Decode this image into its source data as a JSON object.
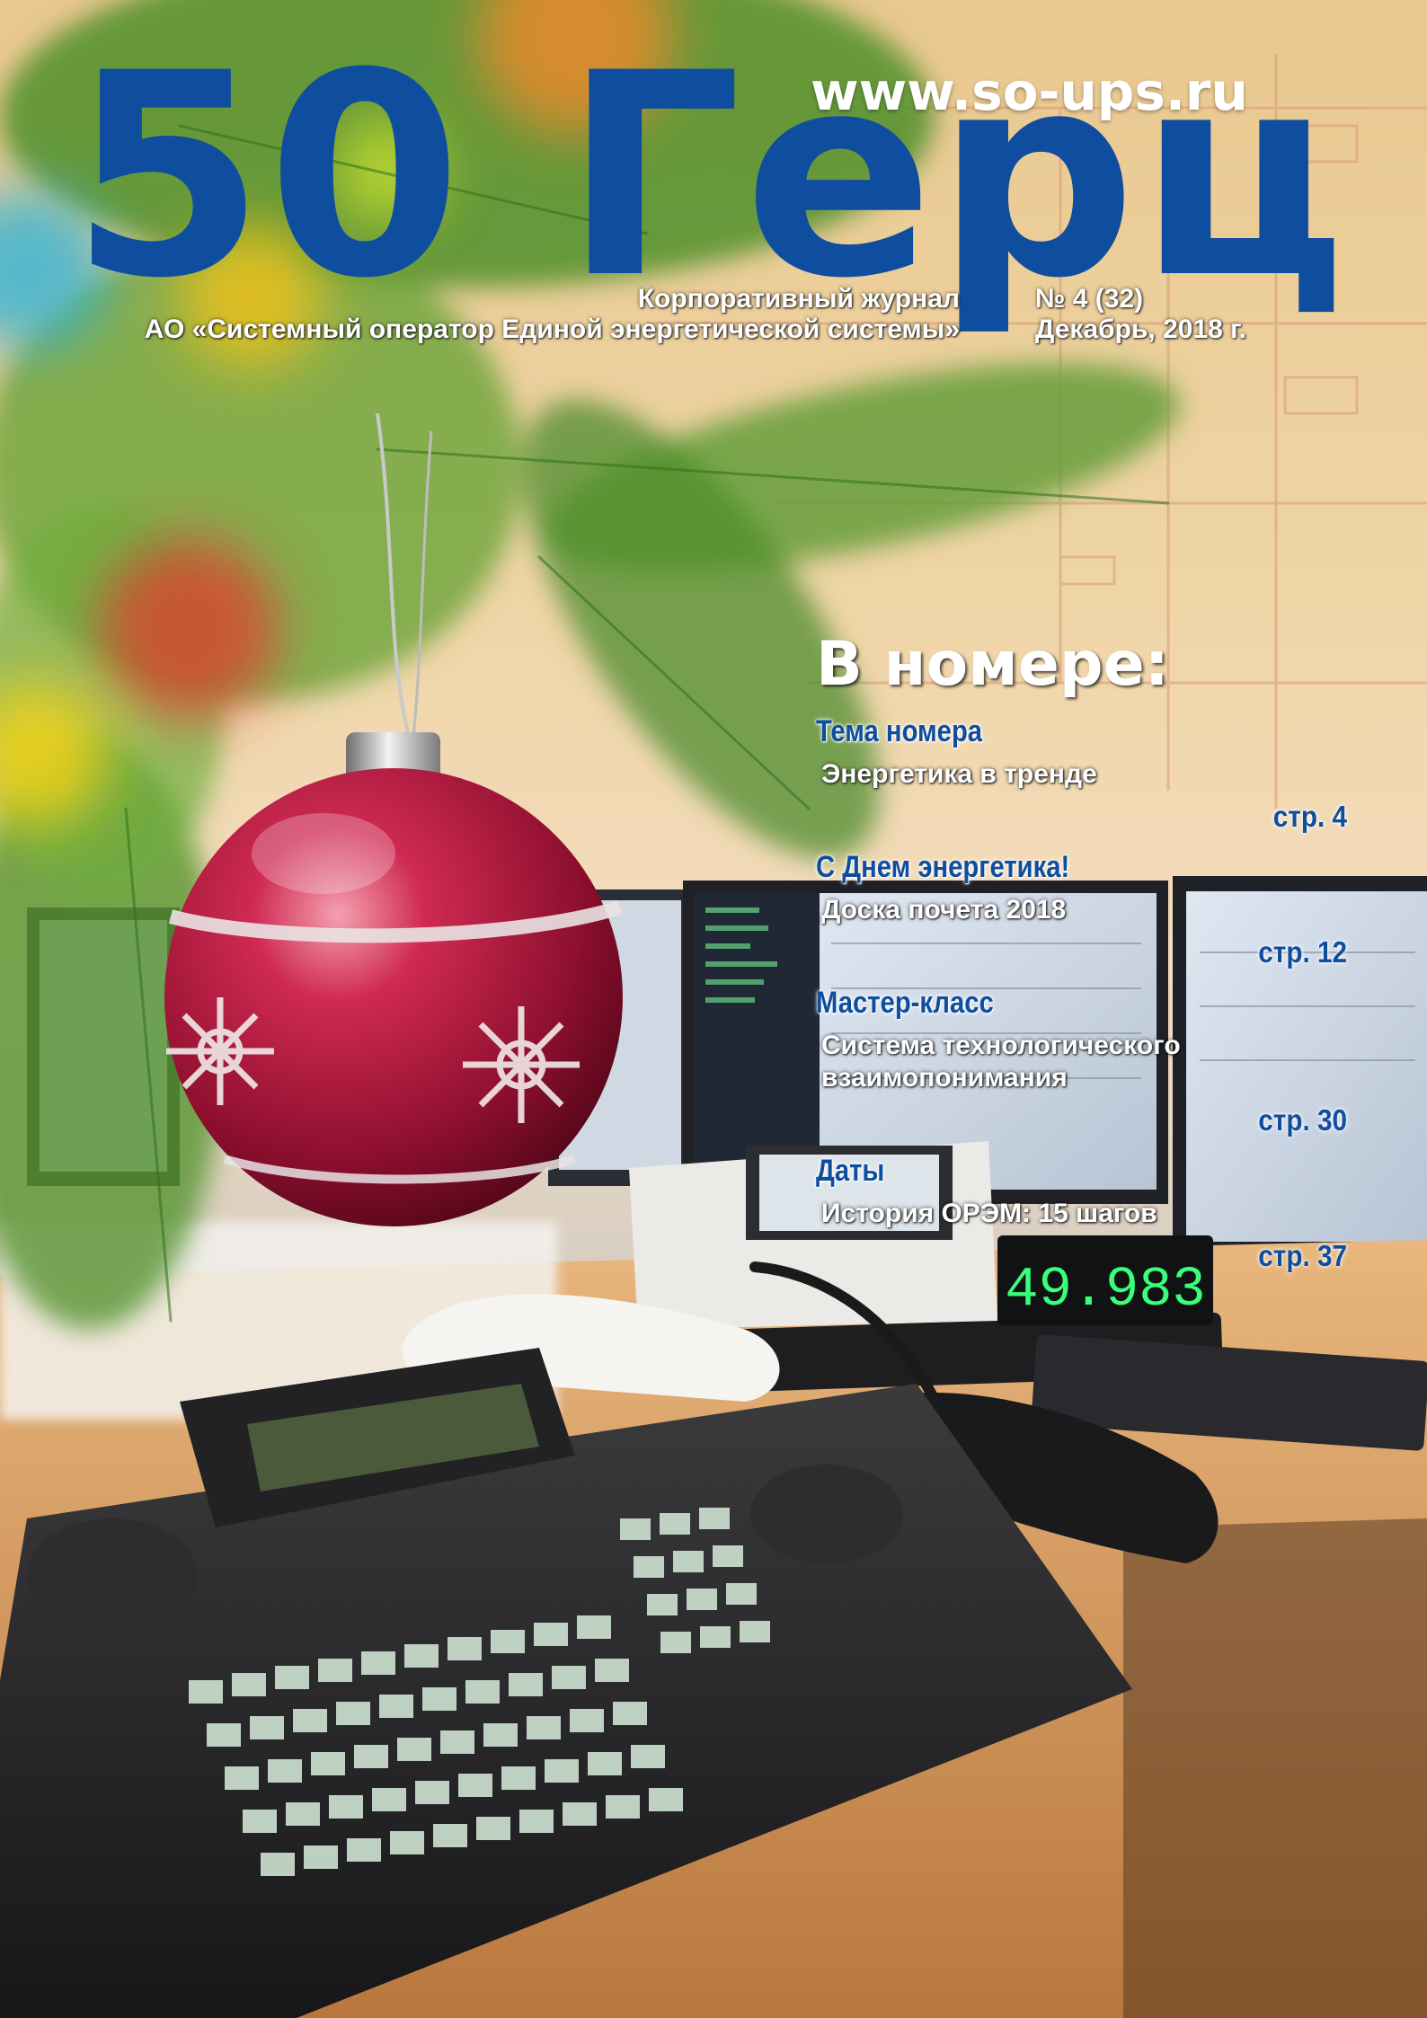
{
  "masthead": {
    "title": "50 Герц",
    "url": "www.so-ups.ru",
    "subtitle_line1": "Корпоративный журнал",
    "subtitle_line2": "АО «Системный оператор Единой энергетической системы»",
    "issue": "№ 4 (32)",
    "date": "Декабрь, 2018 г."
  },
  "contents": {
    "heading": "В номере:",
    "sections": [
      {
        "head": "Тема номера",
        "article": "Энергетика в тренде",
        "page": "стр. 4"
      },
      {
        "head": "С Днем энергетика!",
        "article": "Доска почета 2018",
        "page": "стр. 12"
      },
      {
        "head": "Мастер-класс",
        "article": "Система технологического взаимопонимания",
        "page": "стр. 30"
      },
      {
        "head": "Даты",
        "article": "История ОРЭМ: 15 шагов",
        "page": "стр. 37"
      }
    ]
  },
  "photo": {
    "frequency_display": "49.983"
  },
  "colors": {
    "brand_blue": "#0f4e9e",
    "text_white": "#ffffff",
    "ornament_red": "#b0183a",
    "display_green": "#39ff7a"
  }
}
